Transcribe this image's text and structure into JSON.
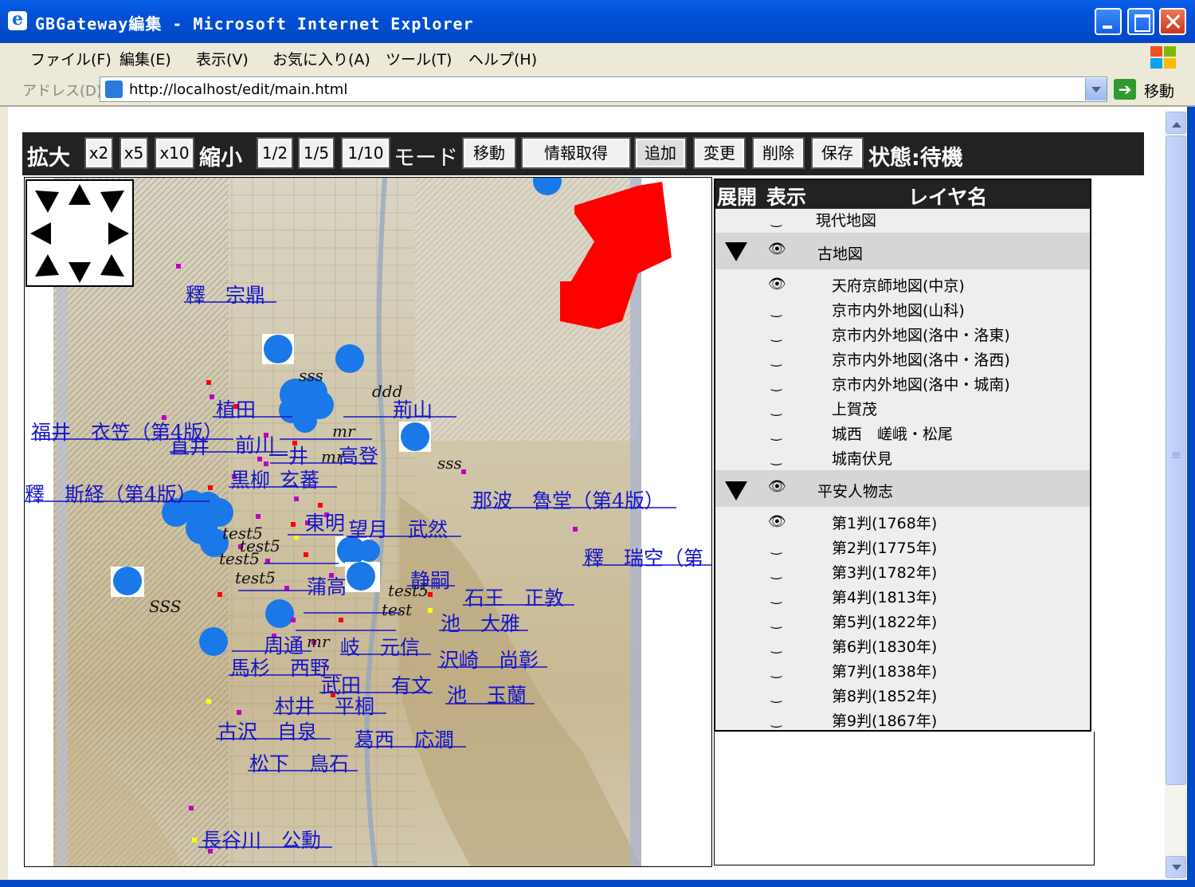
{
  "window": {
    "title": "GBGateway編集 - Microsoft Internet Explorer"
  },
  "menu": [
    "ファイル(F)",
    "編集(E)",
    "表示(V)",
    "お気に入り(A)",
    "ツール(T)",
    "ヘルプ(H)"
  ],
  "address": {
    "label": "アドレス(D)",
    "url": "http://localhost/edit/main.html",
    "go_label": "移動"
  },
  "toolbar": {
    "zoom_in_label": "拡大",
    "zoom_in_buttons": [
      "x2",
      "x5",
      "x10"
    ],
    "zoom_out_label": "縮小",
    "zoom_out_buttons": [
      "1/2",
      "1/5",
      "1/10"
    ],
    "mode_label": "モード",
    "mode_buttons": [
      "移動",
      "情報取得",
      "追加",
      "変更",
      "削除"
    ],
    "save_label": "保存",
    "status": "状態:待機"
  },
  "layers": {
    "col_expand": "展開",
    "col_visible": "表示",
    "col_name": "レイヤ名",
    "rows": [
      {
        "type": "item",
        "visible": false,
        "name": "現代地図"
      },
      {
        "type": "group",
        "visible": true,
        "name": "古地図"
      },
      {
        "type": "child",
        "visible": true,
        "name": "天府京師地図(中京)"
      },
      {
        "type": "child",
        "visible": false,
        "name": "京市内外地図(山科)"
      },
      {
        "type": "child",
        "visible": false,
        "name": "京市内外地図(洛中・洛東)"
      },
      {
        "type": "child",
        "visible": false,
        "name": "京市内外地図(洛中・洛西)"
      },
      {
        "type": "child",
        "visible": false,
        "name": "京市内外地図(洛中・城南)"
      },
      {
        "type": "child",
        "visible": false,
        "name": "上賀茂"
      },
      {
        "type": "child",
        "visible": false,
        "name": "城西　嵯峨・松尾"
      },
      {
        "type": "child",
        "visible": false,
        "name": "城南伏見"
      },
      {
        "type": "group",
        "visible": true,
        "name": "平安人物志"
      },
      {
        "type": "child",
        "visible": true,
        "name": "第1判(1768年)"
      },
      {
        "type": "child",
        "visible": false,
        "name": "第2判(1775年)"
      },
      {
        "type": "child",
        "visible": false,
        "name": "第3判(1782年)"
      },
      {
        "type": "child",
        "visible": false,
        "name": "第4判(1813年)"
      },
      {
        "type": "child",
        "visible": false,
        "name": "第5判(1822年)"
      },
      {
        "type": "child",
        "visible": false,
        "name": "第6判(1830年)"
      },
      {
        "type": "child",
        "visible": false,
        "name": "第7判(1838年)"
      },
      {
        "type": "child",
        "visible": false,
        "name": "第8判(1852年)"
      },
      {
        "type": "child",
        "visible": false,
        "name": "第9判(1867年)"
      }
    ]
  },
  "map_labels": [
    "釋　宗鼎",
    "福井　衣笠（第4版）",
    "植田",
    "前川",
    "直井",
    "黒柳",
    "一井",
    "玄蕃",
    "高登",
    "釋　斯経（第4版）",
    "那波　魯堂（第4版）",
    "東明",
    "望月　武然",
    "釋　瑞空（第",
    "静嗣",
    "石王　正敦",
    "蒲高",
    "池　大雅",
    "周通",
    "岐　元信",
    "沢崎　尚彰",
    "馬杉　西野",
    "武田",
    "有文",
    "池　玉蘭",
    "村井　平桐",
    "古沢　自泉",
    "葛西　応澗",
    "松下　鳥石",
    "長谷川　公勳",
    "荊山"
  ],
  "map_annotations": [
    "sss",
    "ddd",
    "mr",
    "test5",
    "test",
    "SSS"
  ],
  "colors": {
    "toolbar_bg": "#222222",
    "link": "#1515c8",
    "marker_blue": "#1a78e8",
    "marker_red": "#ff0000",
    "marker_purple": "#c000c0",
    "annotation_red": "#ff0000"
  }
}
